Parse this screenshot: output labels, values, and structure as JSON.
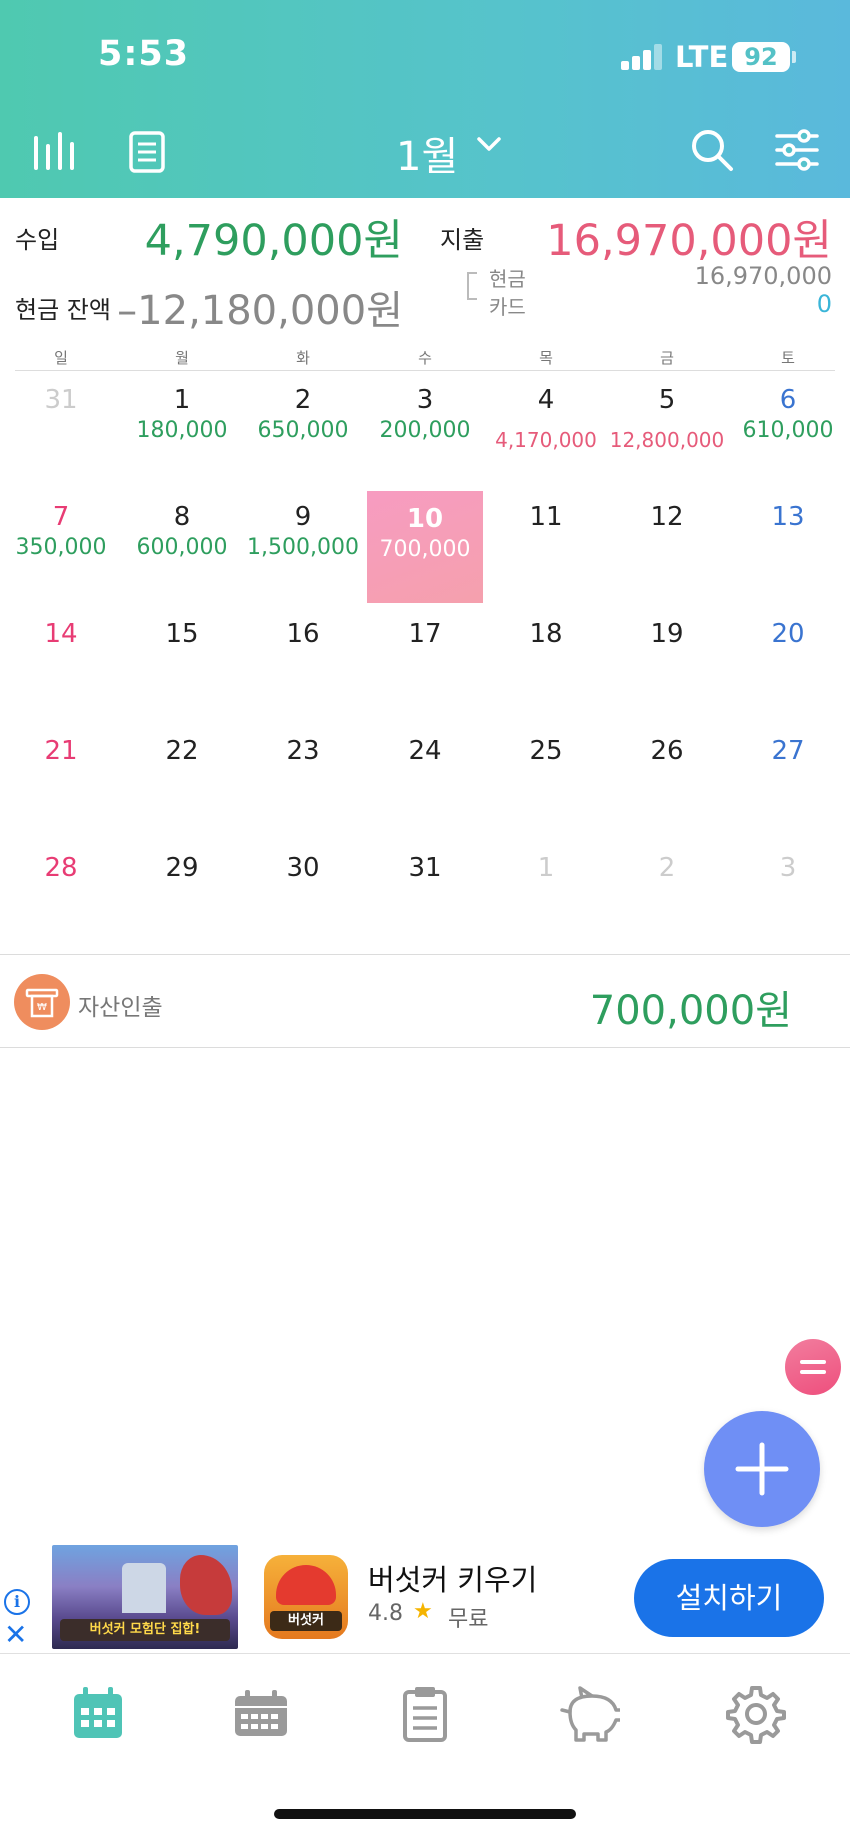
{
  "status_bar": {
    "time": "5:53",
    "network": "LTE",
    "battery": "92"
  },
  "header": {
    "month": "1월"
  },
  "summary": {
    "income_label": "수입",
    "income_value": "4,790,000원",
    "expense_label": "지출",
    "expense_value": "16,970,000원",
    "balance_label": "현금 잔액",
    "balance_value": "–12,180,000원",
    "cash_label": "현금",
    "cash_value": "16,970,000",
    "card_label": "카드",
    "card_value": "0"
  },
  "weekdays": [
    "일",
    "월",
    "화",
    "수",
    "목",
    "금",
    "토"
  ],
  "calendar": [
    [
      {
        "day": "31",
        "amount": "",
        "other": true
      },
      {
        "day": "1",
        "amount": "180,000"
      },
      {
        "day": "2",
        "amount": "650,000"
      },
      {
        "day": "3",
        "amount": "200,000"
      },
      {
        "day": "4",
        "amount": "4,170,000",
        "expense": true
      },
      {
        "day": "5",
        "amount": "12,800,000",
        "expense": true
      },
      {
        "day": "6",
        "amount": "610,000"
      }
    ],
    [
      {
        "day": "7",
        "amount": "350,000"
      },
      {
        "day": "8",
        "amount": "600,000"
      },
      {
        "day": "9",
        "amount": "1,500,000"
      },
      {
        "day": "10",
        "amount": "700,000",
        "today": true
      },
      {
        "day": "11",
        "amount": ""
      },
      {
        "day": "12",
        "amount": ""
      },
      {
        "day": "13",
        "amount": ""
      }
    ],
    [
      {
        "day": "14",
        "amount": ""
      },
      {
        "day": "15",
        "amount": ""
      },
      {
        "day": "16",
        "amount": ""
      },
      {
        "day": "17",
        "amount": ""
      },
      {
        "day": "18",
        "amount": ""
      },
      {
        "day": "19",
        "amount": ""
      },
      {
        "day": "20",
        "amount": ""
      }
    ],
    [
      {
        "day": "21",
        "amount": ""
      },
      {
        "day": "22",
        "amount": ""
      },
      {
        "day": "23",
        "amount": ""
      },
      {
        "day": "24",
        "amount": ""
      },
      {
        "day": "25",
        "amount": ""
      },
      {
        "day": "26",
        "amount": ""
      },
      {
        "day": "27",
        "amount": ""
      }
    ],
    [
      {
        "day": "28",
        "amount": ""
      },
      {
        "day": "29",
        "amount": ""
      },
      {
        "day": "30",
        "amount": ""
      },
      {
        "day": "31",
        "amount": ""
      },
      {
        "day": "1",
        "amount": "",
        "other": true
      },
      {
        "day": "2",
        "amount": "",
        "other": true
      },
      {
        "day": "3",
        "amount": "",
        "other": true
      }
    ]
  ],
  "transaction": {
    "icon": "atm-withdraw-icon",
    "label": "자산인출",
    "amount": "700,000원"
  },
  "ad": {
    "banner_text": "버섯커 모험단 집합!",
    "app_icon_text": "버섯커",
    "app_name": "버섯커 키우기",
    "rating": "4.8",
    "price": "무료",
    "install_label": "설치하기"
  },
  "tabs": [
    "calendar-icon",
    "weekly-calendar-icon",
    "notes-icon",
    "piggy-bank-icon",
    "gear-icon"
  ],
  "colors": {
    "header_start": "#4fc9b0",
    "header_end": "#5ab9dc",
    "income": "#2e9e5e",
    "expense": "#e65b7a",
    "accent": "#6f8ff5",
    "today": "#f79cc1"
  }
}
